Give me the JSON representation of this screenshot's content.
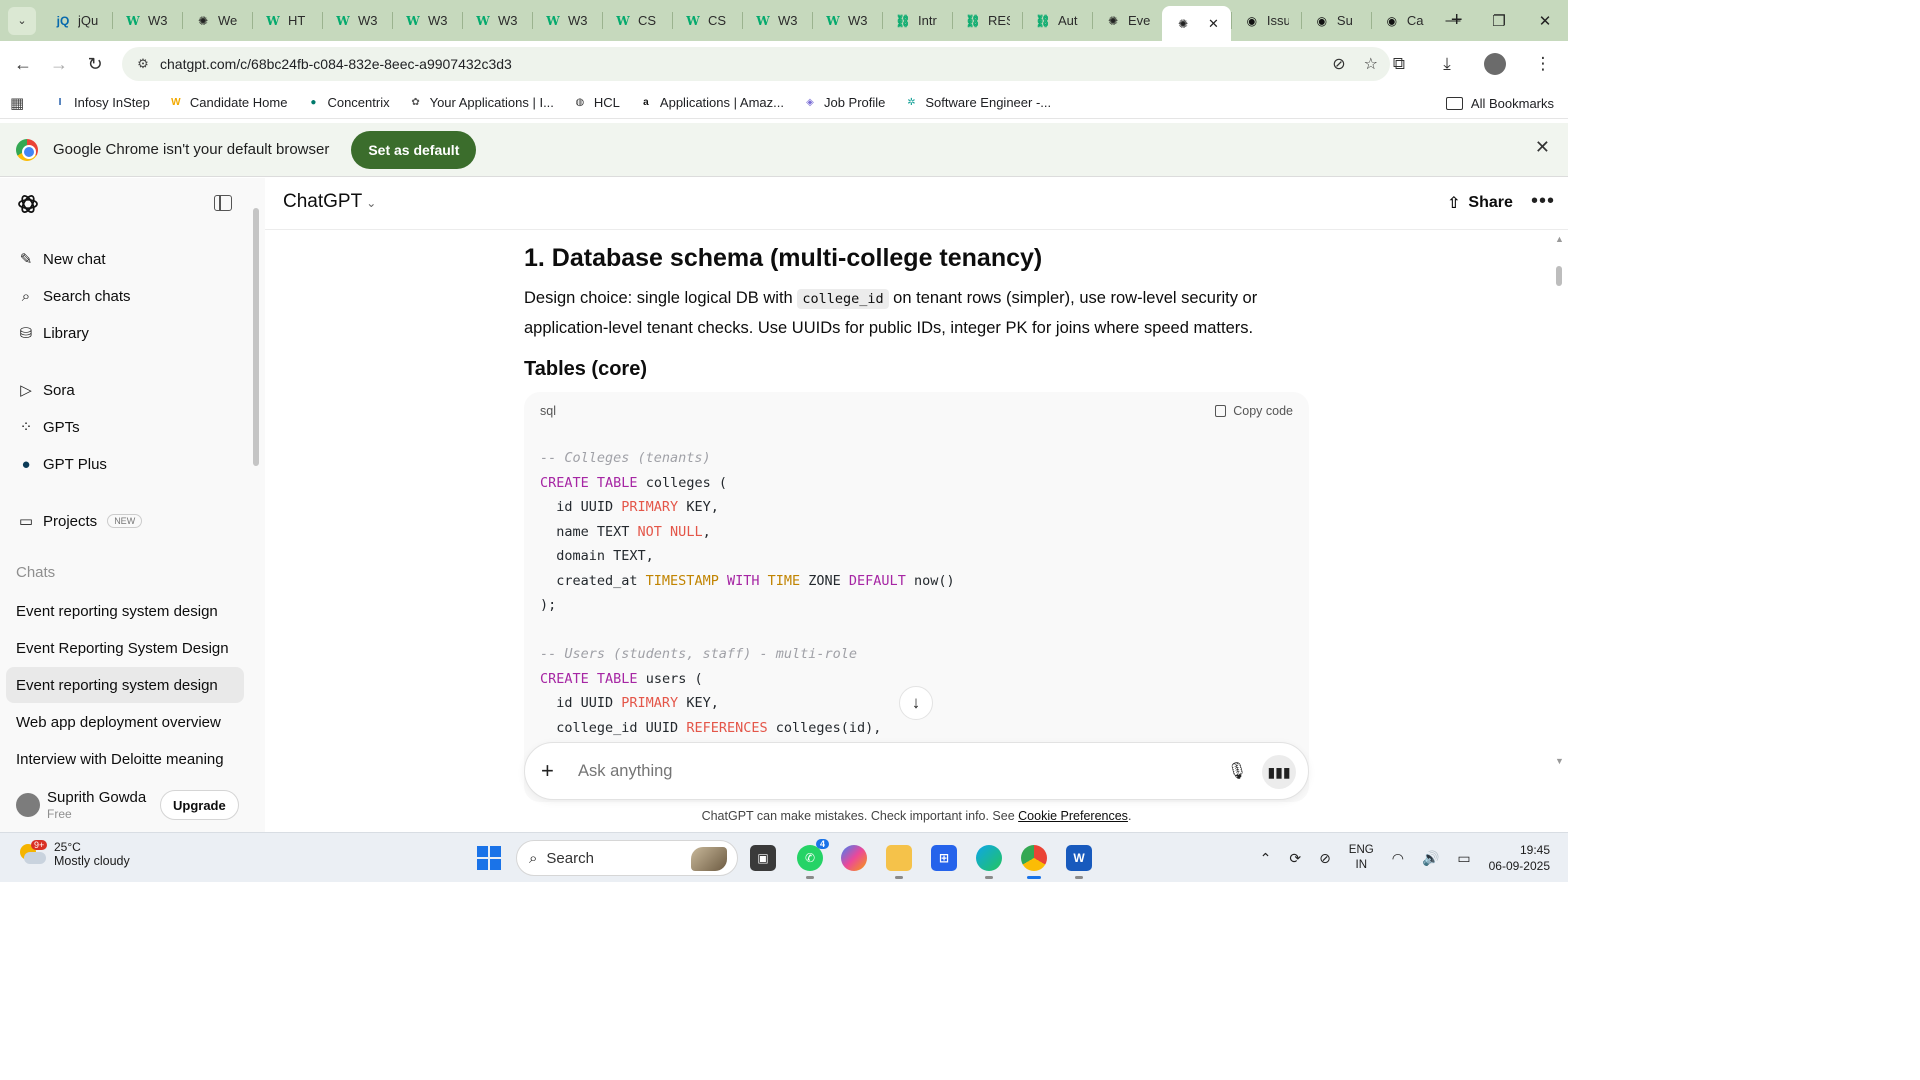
{
  "browser": {
    "tabs": [
      {
        "favicon": "jquery-icon",
        "label": "jQu"
      },
      {
        "favicon": "w3schools-icon",
        "label": "W3"
      },
      {
        "favicon": "chatgpt-icon",
        "label": "We"
      },
      {
        "favicon": "w3schools-icon",
        "label": "HT"
      },
      {
        "favicon": "w3schools-icon",
        "label": "W3"
      },
      {
        "favicon": "w3schools-icon",
        "label": "W3"
      },
      {
        "favicon": "w3schools-icon",
        "label": "W3"
      },
      {
        "favicon": "w3schools-icon",
        "label": "W3"
      },
      {
        "favicon": "w3schools-icon",
        "label": "CS"
      },
      {
        "favicon": "w3schools-icon",
        "label": "CS"
      },
      {
        "favicon": "w3schools-icon",
        "label": "W3"
      },
      {
        "favicon": "w3schools-icon",
        "label": "W3"
      },
      {
        "favicon": "link-icon",
        "label": "Intr"
      },
      {
        "favicon": "link-icon",
        "label": "RES"
      },
      {
        "favicon": "link-icon",
        "label": "Aut"
      },
      {
        "favicon": "chatgpt-icon",
        "label": "Eve"
      },
      {
        "favicon": "chatgpt-icon",
        "label": "",
        "active": true
      },
      {
        "favicon": "github-icon",
        "label": "Issu"
      },
      {
        "favicon": "github-icon",
        "label": "Su"
      },
      {
        "favicon": "github-icon",
        "label": "Ca"
      }
    ],
    "url": "chatgpt.com/c/68bc24fb-c084-832e-8eec-a9907432c3d3",
    "bookmarks": [
      {
        "icon": "infosys-icon",
        "label": "Infosy InStep",
        "color": "#1e5aa8"
      },
      {
        "icon": "candidate-icon",
        "label": "Candidate Home",
        "color": "#f2a900"
      },
      {
        "icon": "concentrix-icon",
        "label": "Concentrix",
        "color": "#00796b"
      },
      {
        "icon": "applications-icon",
        "label": "Your Applications | I...",
        "color": "#555555"
      },
      {
        "icon": "globe-icon",
        "label": "HCL",
        "color": "#333333"
      },
      {
        "icon": "amazon-icon",
        "label": "Applications | Amaz...",
        "color": "#111111"
      },
      {
        "icon": "profile-icon",
        "label": "Job Profile",
        "color": "#7b6fd6"
      },
      {
        "icon": "gear-icon",
        "label": "Software Engineer -...",
        "color": "#1aa39a"
      }
    ],
    "all_bookmarks": "All Bookmarks",
    "infobar": {
      "message": "Google Chrome isn't your default browser",
      "button": "Set as default"
    }
  },
  "sidebar": {
    "nav": [
      {
        "icon": "edit-icon",
        "label": "New chat"
      },
      {
        "icon": "search-icon",
        "label": "Search chats"
      },
      {
        "icon": "library-icon",
        "label": "Library"
      },
      {
        "icon": "sora-icon",
        "label": "Sora"
      },
      {
        "icon": "gpts-icon",
        "label": "GPTs"
      },
      {
        "icon": "gpt-plus-icon",
        "label": "GPT Plus"
      },
      {
        "icon": "folder-icon",
        "label": "Projects",
        "badge": "NEW"
      }
    ],
    "section_title": "Chats",
    "chats": [
      {
        "label": "Event reporting system design",
        "selected": false
      },
      {
        "label": "Event Reporting System Design",
        "selected": false
      },
      {
        "label": "Event reporting system design",
        "selected": true
      },
      {
        "label": "Web app deployment overview",
        "selected": false
      },
      {
        "label": "Interview with Deloitte meaning",
        "selected": false
      }
    ],
    "user": {
      "name": "Suprith Gowda",
      "plan": "Free",
      "upgrade": "Upgrade"
    }
  },
  "main": {
    "model": "ChatGPT",
    "share": "Share",
    "heading": "1. Database schema (multi-college tenancy)",
    "para_before": "Design choice: single logical DB with ",
    "para_code": "college_id",
    "para_after": " on tenant rows (simpler), use row-level security or application-level tenant checks. Use UUIDs for public IDs, integer PK for joins where speed matters.",
    "subheading": "Tables (core)",
    "code_lang": "sql",
    "copy_label": "Copy code",
    "composer_placeholder": "Ask anything",
    "disclaimer": "ChatGPT can make mistakes. Check important info. See ",
    "disclaimer_link": "Cookie Preferences",
    "disclaimer_end": "."
  },
  "taskbar": {
    "weather_temp": "25°C",
    "weather_desc": "Mostly cloudy",
    "weather_badge": "9+",
    "search": "Search",
    "whatsapp_badge": "4",
    "lang_1": "ENG",
    "lang_2": "IN",
    "time": "19:45",
    "date": "06-09-2025"
  }
}
